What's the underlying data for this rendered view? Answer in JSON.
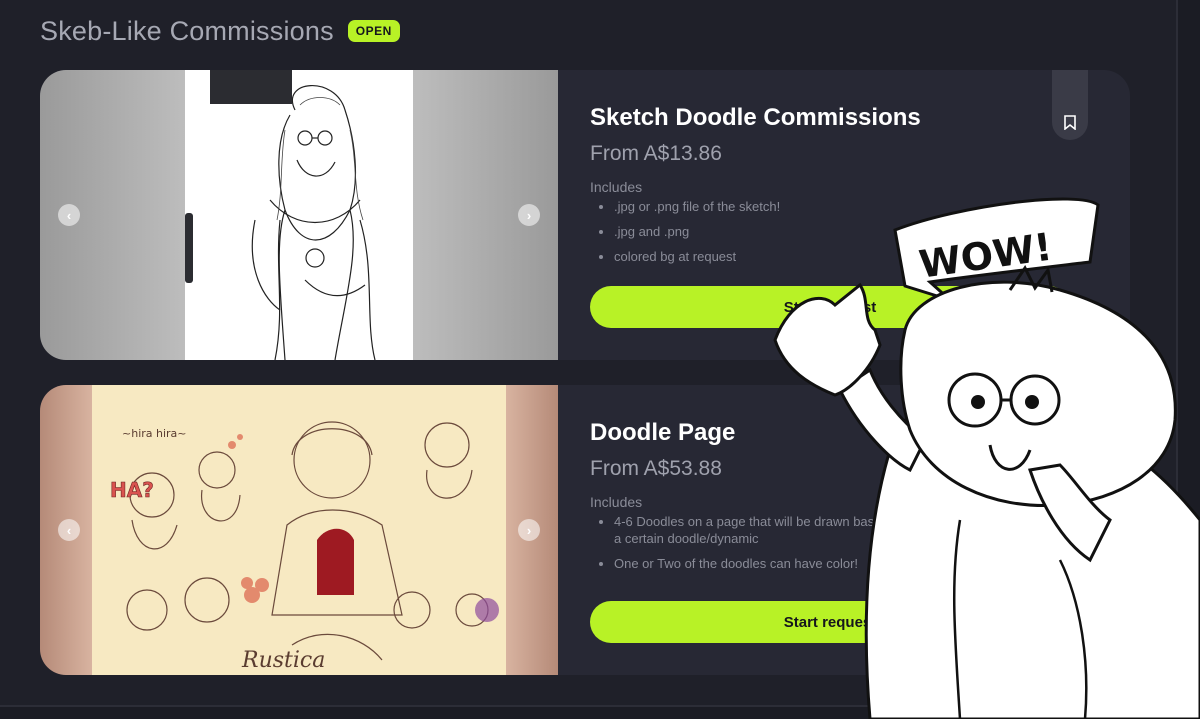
{
  "header": {
    "title": "Skeb-Like Commissions",
    "status_badge": "OPEN"
  },
  "cards": [
    {
      "title": "Sketch Doodle Commissions",
      "price": "From A$13.86",
      "includes_label": "Includes",
      "features": [
        ".jpg or .png file of the sketch!",
        ".jpg and .png",
        "colored bg at request"
      ],
      "cta_label": "Start request"
    },
    {
      "title": "Doodle Page",
      "price": "From A$53.88",
      "includes_label": "Includes",
      "features": [
        "4-6 Doodles on a page that will be drawn based on specific requests  on a certain doodle/dynamic",
        "One or Two of the doodles can have color!"
      ],
      "cta_label": "Start request"
    }
  ],
  "artwork_text": {
    "speech_bubble": "WOW!",
    "doodle_ha": "HA?",
    "doodle_hira": "~hira hira~",
    "doodle_sig": "Rustica"
  },
  "icons": {
    "prev": "chevron-left-icon",
    "next": "chevron-right-icon",
    "bookmark": "bookmark-icon"
  },
  "colors": {
    "accent": "#b8f226",
    "background": "#1f2029",
    "card": "#272834"
  }
}
